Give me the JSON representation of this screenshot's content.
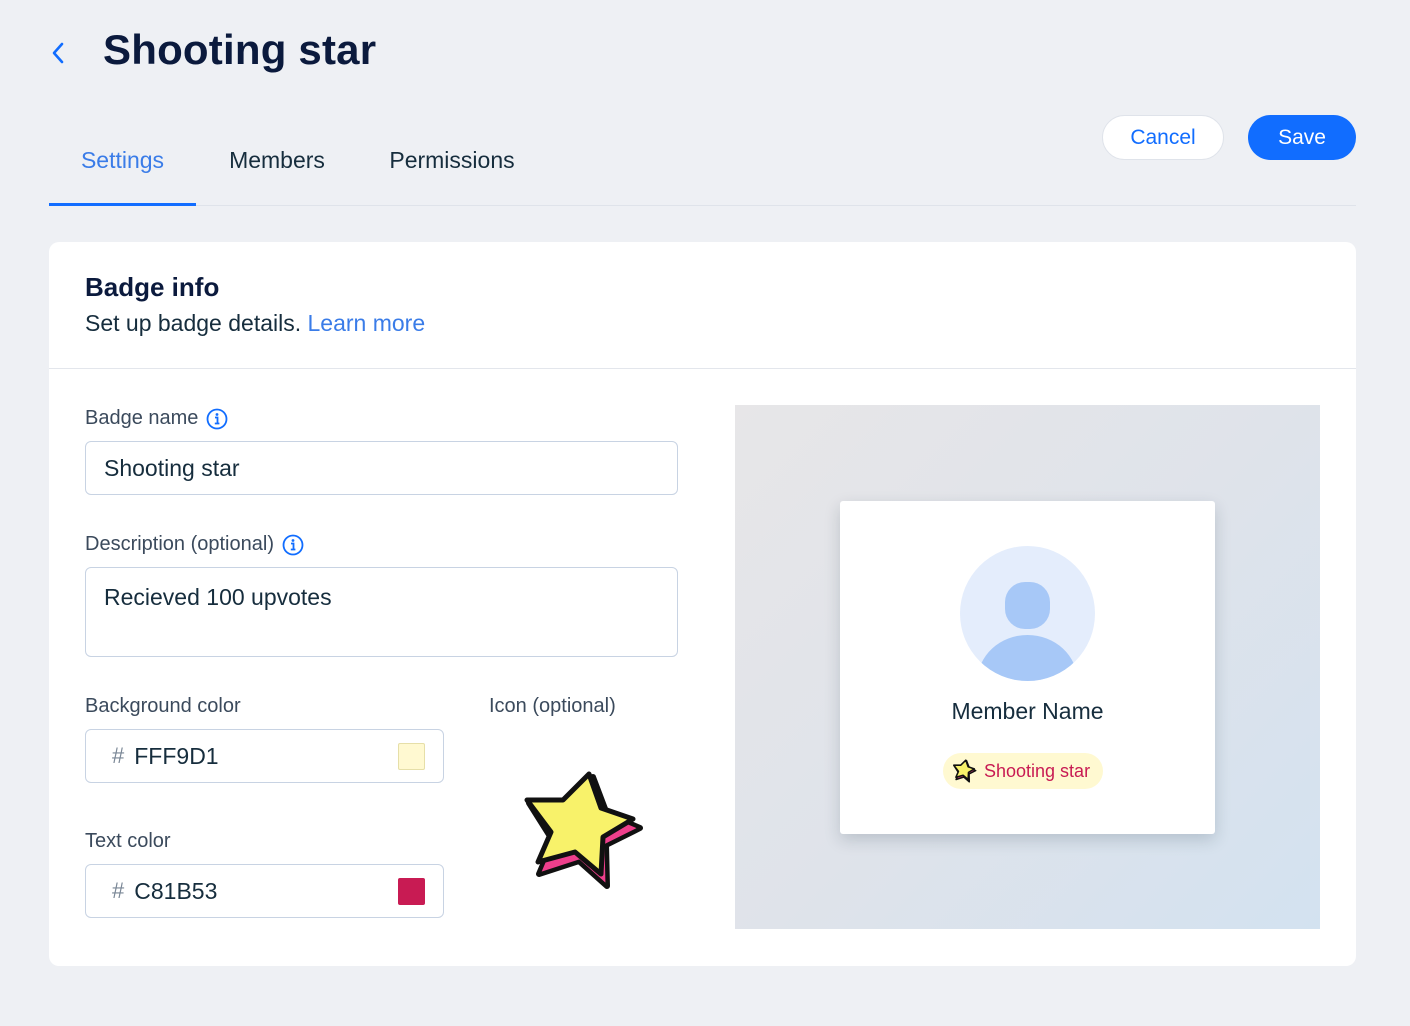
{
  "header": {
    "title": "Shooting star"
  },
  "tabs": [
    {
      "label": "Settings",
      "active": true
    },
    {
      "label": "Members",
      "active": false
    },
    {
      "label": "Permissions",
      "active": false
    }
  ],
  "actions": {
    "cancel_label": "Cancel",
    "save_label": "Save"
  },
  "badge_info": {
    "title": "Badge info",
    "subtitle": "Set up badge details.",
    "learn_more": "Learn more"
  },
  "form": {
    "name_label": "Badge name",
    "name_value": "Shooting star",
    "description_label": "Description (optional)",
    "description_value": "Recieved 100 upvotes",
    "bg_color_label": "Background color",
    "bg_color_value": "FFF9D1",
    "text_color_label": "Text color",
    "text_color_value": "C81B53",
    "icon_label": "Icon (optional)",
    "hash_symbol": "#"
  },
  "preview": {
    "member_name": "Member Name",
    "badge_label": "Shooting star"
  },
  "colors": {
    "accent": "#116dff",
    "badge_bg": "#FFF9D1",
    "badge_text": "#C81B53",
    "star_fill": "#f8f26a",
    "star_side": "#ee3f8c"
  },
  "icons": [
    "chevron-left-icon",
    "info-icon",
    "star-icon",
    "avatar-icon"
  ]
}
